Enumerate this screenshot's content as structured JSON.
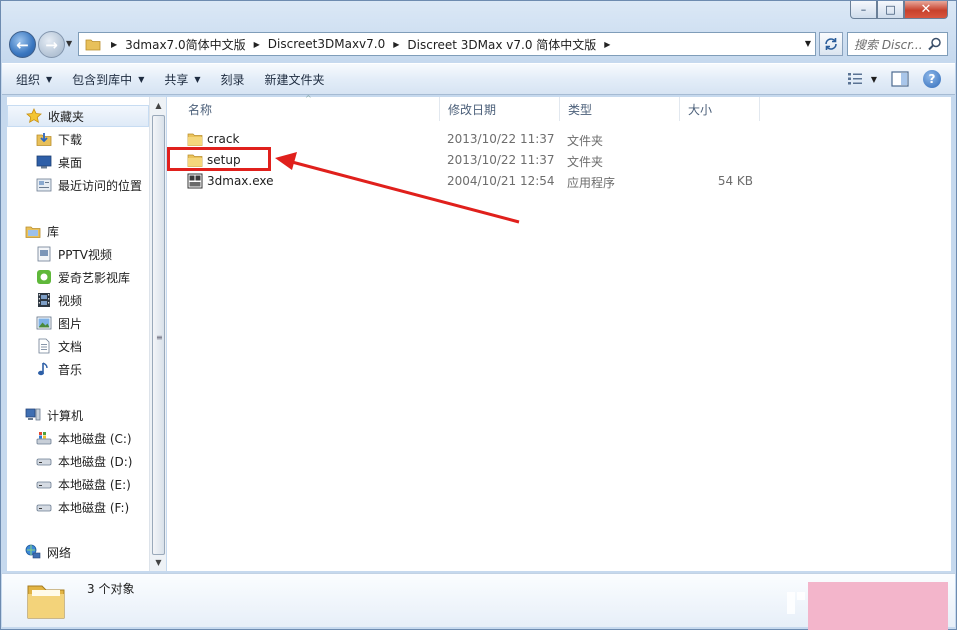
{
  "window": {
    "minimize_glyph": "–",
    "maximize_glyph": "□",
    "close_glyph": "✕"
  },
  "nav": {
    "back_glyph": "←",
    "forward_glyph": "→",
    "breadcrumbs": [
      "3dmax7.0简体中文版",
      "Discreet3DMaxv7.0",
      "Discreet 3DMax v7.0 简体中文版"
    ],
    "search_placeholder": "搜索 Discr..."
  },
  "toolbar": {
    "organize": "组织",
    "include_in_library": "包含到库中",
    "share": "共享",
    "burn": "刻录",
    "new_folder": "新建文件夹",
    "help_glyph": "?"
  },
  "sidebar": {
    "favorites": "收藏夹",
    "downloads": "下载",
    "desktop": "桌面",
    "recent": "最近访问的位置",
    "libraries": "库",
    "pptv": "PPTV视频",
    "iqiyi": "爱奇艺影视库",
    "videos": "视频",
    "pictures": "图片",
    "documents": "文档",
    "music": "音乐",
    "computer": "计算机",
    "drive_c": "本地磁盘 (C:)",
    "drive_d": "本地磁盘 (D:)",
    "drive_e": "本地磁盘 (E:)",
    "drive_f": "本地磁盘 (F:)",
    "network": "网络"
  },
  "columns": {
    "name": "名称",
    "modified": "修改日期",
    "type": "类型",
    "size": "大小"
  },
  "files": [
    {
      "name": "crack",
      "modified": "2013/10/22 11:37",
      "type": "文件夹",
      "size": ""
    },
    {
      "name": "setup",
      "modified": "2013/10/22 11:37",
      "type": "文件夹",
      "size": ""
    },
    {
      "name": "3dmax.exe",
      "modified": "2004/10/21 12:54",
      "type": "应用程序",
      "size": "54 KB"
    }
  ],
  "details": {
    "count": "3 个对象"
  },
  "colors": {
    "annotation_red": "#e0201c",
    "watermark_pink": "#f3b5cb"
  }
}
